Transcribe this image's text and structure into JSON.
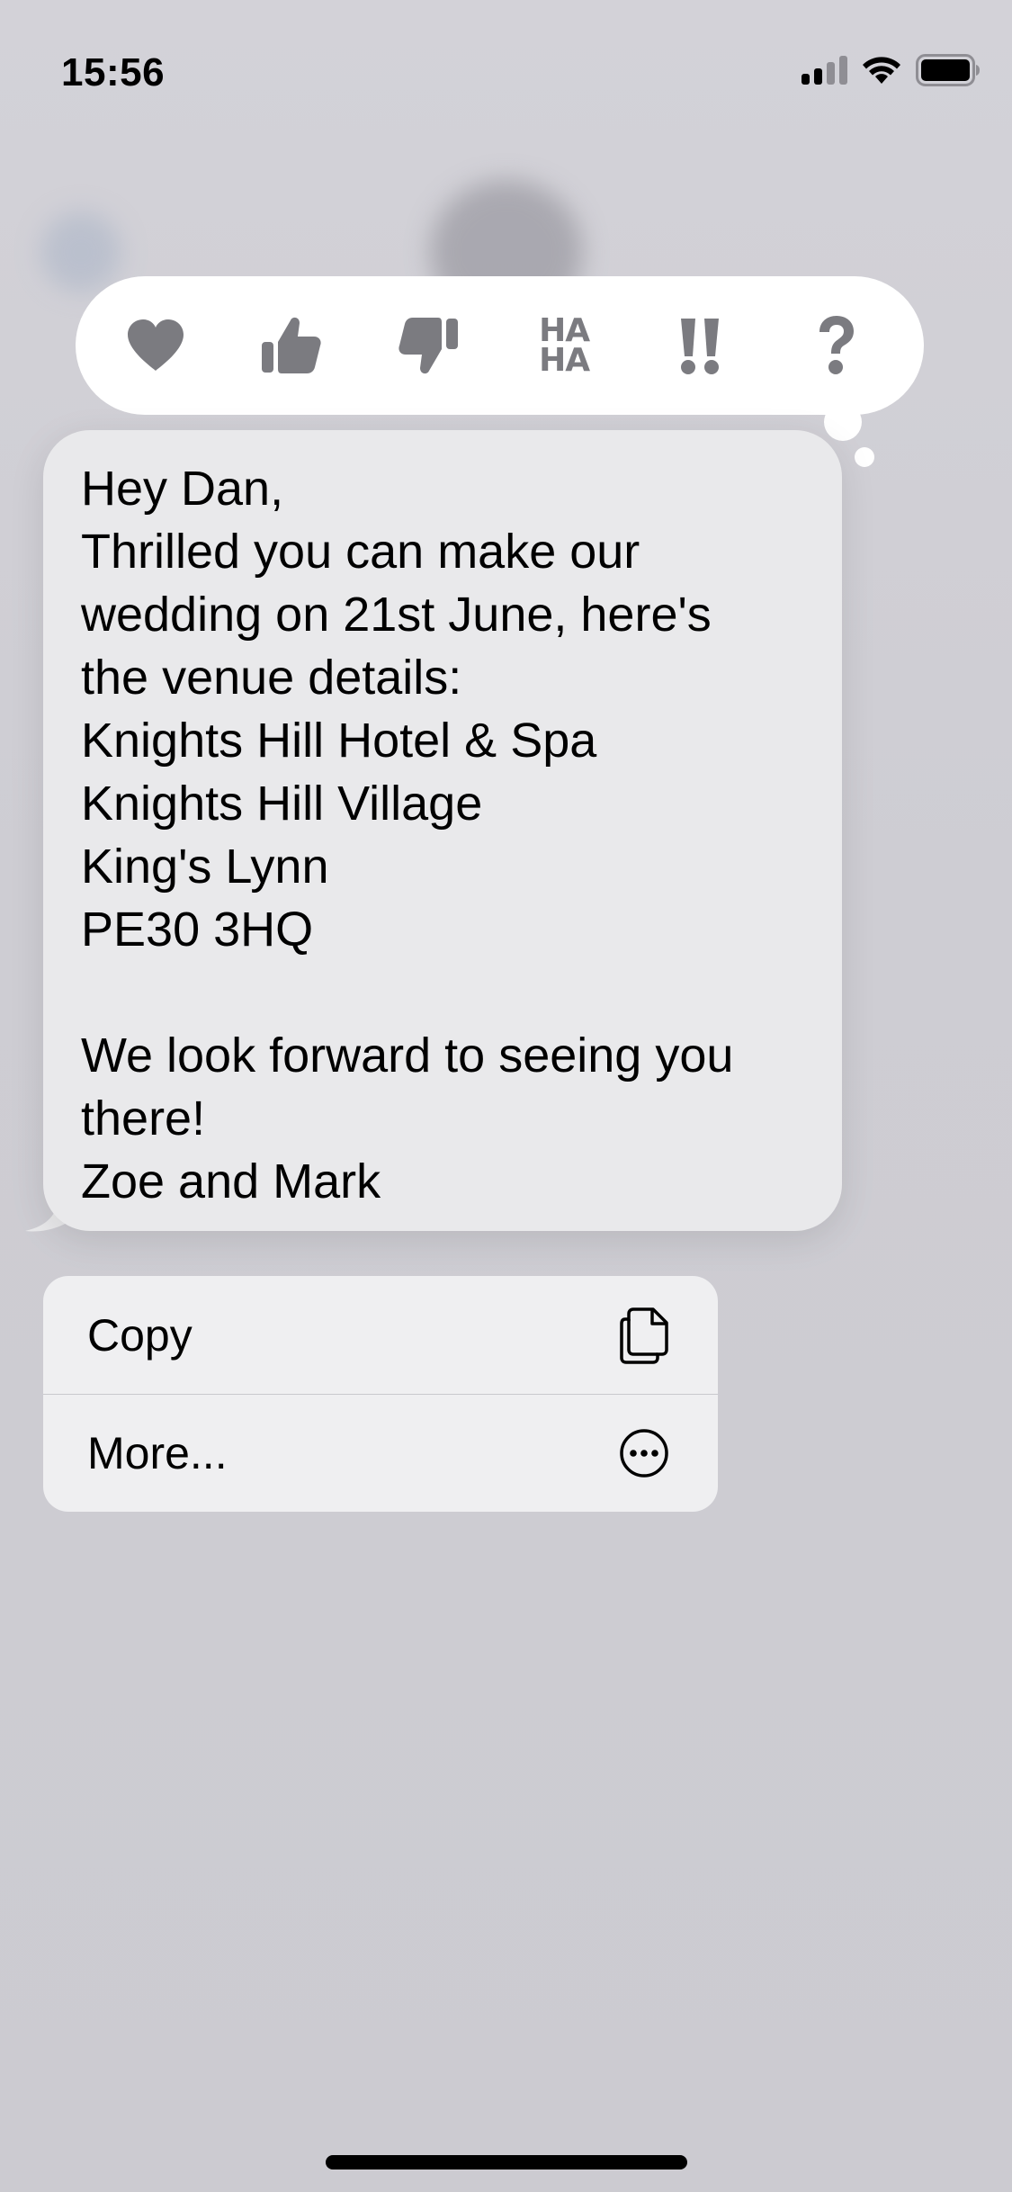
{
  "status_bar": {
    "time": "15:56"
  },
  "reactions": [
    {
      "name": "heart-icon",
      "label": "Heart"
    },
    {
      "name": "thumbs-up-icon",
      "label": "Like"
    },
    {
      "name": "thumbs-down-icon",
      "label": "Dislike"
    },
    {
      "name": "haha-icon",
      "label": "HA HA"
    },
    {
      "name": "exclamation-icon",
      "label": "!!"
    },
    {
      "name": "question-icon",
      "label": "?"
    }
  ],
  "reaction_haha_text": {
    "line1": "HA",
    "line2": "HA"
  },
  "message": {
    "lines": [
      "Hey Dan,",
      "Thrilled you can make our",
      "wedding on 21st June, here's",
      "the venue details:",
      "Knights Hill Hotel & Spa",
      "Knights Hill Village",
      "King's Lynn",
      "PE30 3HQ",
      "",
      "We look forward to seeing you",
      "there!",
      "Zoe and Mark"
    ]
  },
  "context_menu": {
    "copy_label": "Copy",
    "more_label": "More..."
  },
  "colors": {
    "reaction_icon": "#7b7b80",
    "bubble": "#e9e9eb",
    "background": "#cfced4"
  }
}
